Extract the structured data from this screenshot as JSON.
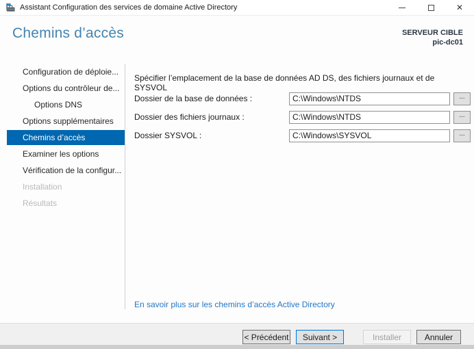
{
  "window": {
    "title": "Assistant Configuration des services de domaine Active Directory",
    "close_glyph": "✕"
  },
  "header": {
    "page_title": "Chemins d’accès",
    "target_server_label": "SERVEUR CIBLE",
    "target_server_name": "pic-dc01"
  },
  "sidebar": {
    "items": [
      {
        "label": "Configuration de déploie...",
        "state": "normal"
      },
      {
        "label": "Options du contrôleur de...",
        "state": "normal"
      },
      {
        "label": "Options DNS",
        "state": "normal",
        "indent": true
      },
      {
        "label": "Options supplémentaires",
        "state": "normal"
      },
      {
        "label": "Chemins d’accès",
        "state": "selected"
      },
      {
        "label": "Examiner les options",
        "state": "normal"
      },
      {
        "label": "Vérification de la configur...",
        "state": "normal"
      },
      {
        "label": "Installation",
        "state": "disabled"
      },
      {
        "label": "Résultats",
        "state": "disabled"
      }
    ]
  },
  "main": {
    "description": "Spécifier l’emplacement de la base de données AD DS, des fichiers journaux et de SYSVOL",
    "fields": [
      {
        "label": "Dossier de la base de données :",
        "value": "C:\\Windows\\NTDS",
        "browse": "..."
      },
      {
        "label": "Dossier des fichiers journaux :",
        "value": "C:\\Windows\\NTDS",
        "browse": "..."
      },
      {
        "label": "Dossier SYSVOL :",
        "value": "C:\\Windows\\SYSVOL",
        "browse": "..."
      }
    ],
    "link": "En savoir plus sur les chemins d’accès Active Directory"
  },
  "footer": {
    "previous": "< Précédent",
    "next": "Suivant >",
    "install": "Installer",
    "cancel": "Annuler"
  },
  "colors": {
    "accent_blue": "#0067b0",
    "title_blue": "#4484b0",
    "link_blue": "#2376c6",
    "next_button_border": "#0078d7"
  }
}
